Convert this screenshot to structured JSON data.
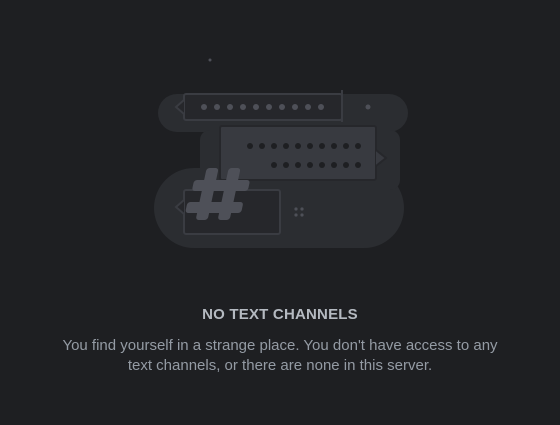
{
  "empty_state": {
    "icon": "no-text-channels-illustration",
    "title": "NO TEXT CHANNELS",
    "description": "You find yourself in a strange place. You don't have access to any text channels, or there are none in this server."
  },
  "colors": {
    "background": "#1e1f22",
    "title": "#b5bac1",
    "description": "#949ba4",
    "illustration_dark": "#2b2d31",
    "illustration_mid": "#313338",
    "illustration_light": "#404249",
    "hash": "#4e5058"
  }
}
